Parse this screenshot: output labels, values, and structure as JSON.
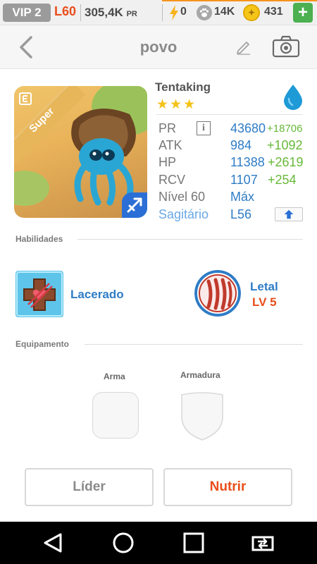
{
  "topbar": {
    "vip": "VIP 2",
    "level": "L60",
    "pr_value": "305,4K",
    "pr_suffix": "PR",
    "energy": "0",
    "paw_count": "14K",
    "coins": "431",
    "add_label": "+"
  },
  "header": {
    "title": "povo"
  },
  "card": {
    "rarity": "Super"
  },
  "monster": {
    "name": "Tentaking",
    "stars": "★★★",
    "stats": {
      "pr_label": "PR",
      "pr_value": "43680",
      "pr_bonus": "+18706",
      "atk_label": "ATK",
      "atk_value": "984",
      "atk_bonus": "+1092",
      "hp_label": "HP",
      "hp_value": "11388",
      "hp_bonus": "+2619",
      "rcv_label": "RCV",
      "rcv_value": "1107",
      "rcv_bonus": "+254",
      "level_label": "Nível 60",
      "level_value": "Máx",
      "sign_label": "Sagitário",
      "sign_value": "L56"
    }
  },
  "skills": {
    "heading": "Habilidades",
    "active_name": "Lacerado",
    "leader_name": "Letal",
    "leader_level": "LV 5"
  },
  "equipment": {
    "heading": "Equipamento",
    "weapon_label": "Arma",
    "armor_label": "Armadura"
  },
  "actions": {
    "leader_button": "Líder",
    "feed_button": "Nutrir"
  },
  "colors": {
    "accent_orange": "#e94e1b",
    "stat_blue": "#2e7cc6",
    "bonus_green": "#67b839",
    "coin_gold": "#f5c518"
  }
}
